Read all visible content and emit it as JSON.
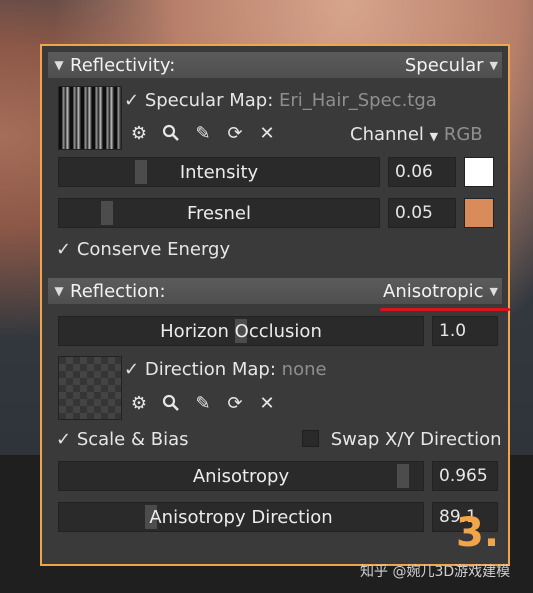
{
  "reflectivity": {
    "title": "Reflectivity:",
    "mode": "Specular",
    "specular_map_label": "Specular Map:",
    "specular_map_file": "Eri_Hair_Spec.tga",
    "channel_label": "Channel",
    "channel_value": "RGB",
    "intensity_label": "Intensity",
    "intensity_value": "0.06",
    "intensity_color": "#ffffff",
    "fresnel_label": "Fresnel",
    "fresnel_value": "0.05",
    "fresnel_color": "#d98b5a",
    "conserve_energy": "Conserve Energy"
  },
  "reflection": {
    "title": "Reflection:",
    "mode": "Anisotropic",
    "horizon_occlusion_label": "Horizon Occlusion",
    "horizon_occlusion_value": "1.0",
    "direction_map_label": "Direction Map:",
    "direction_map_value": "none",
    "scale_bias": "Scale & Bias",
    "swap_xy": "Swap X/Y Direction",
    "anisotropy_label": "Anisotropy",
    "anisotropy_value": "0.965",
    "anisotropy_direction_label": "Anisotropy Direction",
    "anisotropy_direction_value": "89.1"
  },
  "annotation": "3.",
  "watermark": "知乎 @婉儿3D游戏建模",
  "colors": {
    "panel_border": "#f0a54b",
    "underline": "#d8141b"
  },
  "icons": [
    "triangle-down-icon",
    "checkmark-icon",
    "gear-icon",
    "search-icon",
    "pencil-icon",
    "refresh-icon",
    "close-icon",
    "caret-down-icon"
  ]
}
